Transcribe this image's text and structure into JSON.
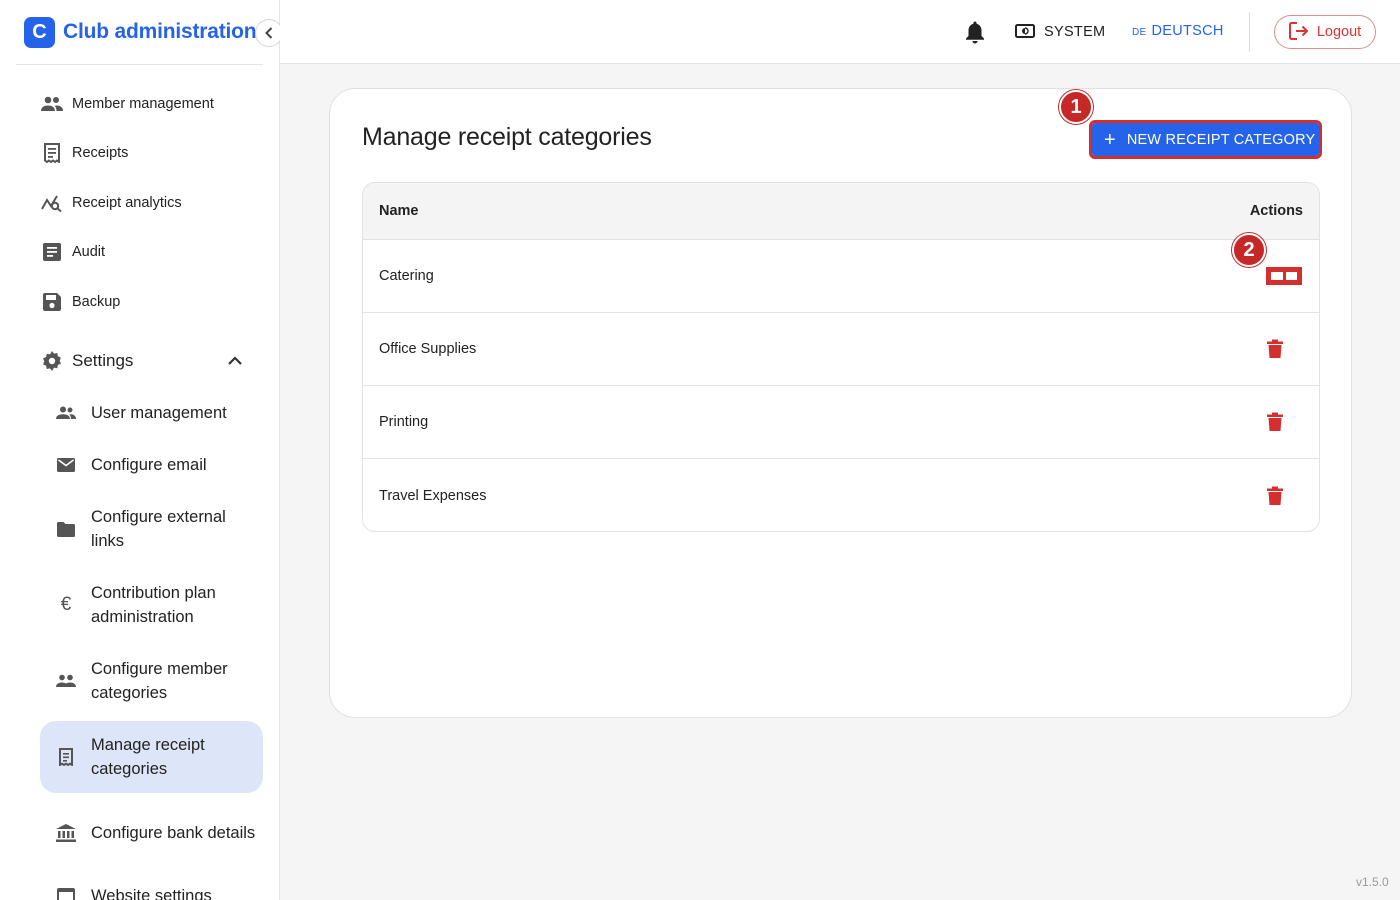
{
  "app": {
    "logo_letter": "C",
    "title": "Club administration"
  },
  "sidebar": {
    "items": [
      {
        "label": "Member management",
        "icon": "people-icon"
      },
      {
        "label": "Receipts",
        "icon": "receipt-icon"
      },
      {
        "label": "Receipt analytics",
        "icon": "analytics-icon"
      },
      {
        "label": "Audit",
        "icon": "audit-icon"
      },
      {
        "label": "Backup",
        "icon": "save-icon"
      }
    ],
    "settings": {
      "label": "Settings",
      "icon": "gear-icon"
    },
    "sub_items": [
      {
        "label": "User management",
        "icon": "users-icon"
      },
      {
        "label": "Configure email",
        "icon": "mail-icon"
      },
      {
        "label": "Configure external links",
        "icon": "folder-icon"
      },
      {
        "label": "Contribution plan administration",
        "icon": "euro-icon"
      },
      {
        "label": "Configure member categories",
        "icon": "group-icon"
      },
      {
        "label": "Manage receipt categories",
        "icon": "receipt-icon",
        "active": true
      },
      {
        "label": "Configure bank details",
        "icon": "bank-icon"
      },
      {
        "label": "Website settings",
        "icon": "web-icon"
      }
    ]
  },
  "header": {
    "system_label": "SYSTEM",
    "language_flag": "DE",
    "language_label": "DEUTSCH",
    "logout_label": "Logout"
  },
  "main": {
    "title": "Manage receipt categories",
    "new_button_label": "NEW RECEIPT CATEGORY",
    "table": {
      "columns": [
        "Name",
        "Actions"
      ],
      "rows": [
        {
          "name": "Catering"
        },
        {
          "name": "Office Supplies"
        },
        {
          "name": "Printing"
        },
        {
          "name": "Travel Expenses"
        }
      ]
    }
  },
  "annotations": [
    "1",
    "2"
  ],
  "version": "v1.5.0",
  "colors": {
    "primary": "#2563eb",
    "danger": "#d32f2f",
    "active_bg": "#dde5f8"
  }
}
